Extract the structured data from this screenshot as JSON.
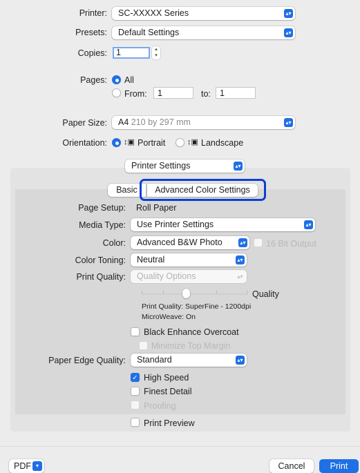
{
  "printer": {
    "label": "Printer:",
    "value": "SC-XXXXX Series"
  },
  "presets": {
    "label": "Presets:",
    "value": "Default Settings"
  },
  "copies": {
    "label": "Copies:",
    "value": "1"
  },
  "pages": {
    "label": "Pages:",
    "all": "All",
    "from_label": "From:",
    "from_value": "1",
    "to_label": "to:",
    "to_value": "1"
  },
  "paper_size": {
    "label": "Paper Size:",
    "value": "A4",
    "detail": "210 by 297 mm"
  },
  "orientation": {
    "label": "Orientation:",
    "portrait": "Portrait",
    "landscape": "Landscape"
  },
  "section": {
    "value": "Printer Settings"
  },
  "tabs": {
    "basic": "Basic",
    "advanced": "Advanced Color Settings"
  },
  "page_setup": {
    "label": "Page Setup:",
    "value": "Roll Paper"
  },
  "media_type": {
    "label": "Media Type:",
    "value": "Use Printer Settings"
  },
  "color": {
    "label": "Color:",
    "value": "Advanced B&W Photo",
    "bit_output": "16 Bit Output"
  },
  "color_toning": {
    "label": "Color Toning:",
    "value": "Neutral"
  },
  "print_quality": {
    "label": "Print Quality:",
    "value": "Quality Options",
    "slider_label": "Quality",
    "info_line1": "Print Quality: SuperFine - 1200dpi",
    "info_line2": "MicroWeave: On"
  },
  "black_enhance": {
    "label": "Black Enhance Overcoat"
  },
  "minimize_margin": {
    "label": "Minimize Top Margin"
  },
  "paper_edge": {
    "label": "Paper Edge Quality:",
    "value": "Standard"
  },
  "high_speed": {
    "label": "High Speed"
  },
  "finest_detail": {
    "label": "Finest Detail"
  },
  "proofing": {
    "label": "Proofing"
  },
  "print_preview": {
    "label": "Print Preview"
  },
  "footer": {
    "pdf": "PDF",
    "cancel": "Cancel",
    "print": "Print"
  },
  "colors": {
    "accent": "#1f6fe5",
    "window": "#ececec",
    "highlight_ring": "#0a3fd6"
  }
}
